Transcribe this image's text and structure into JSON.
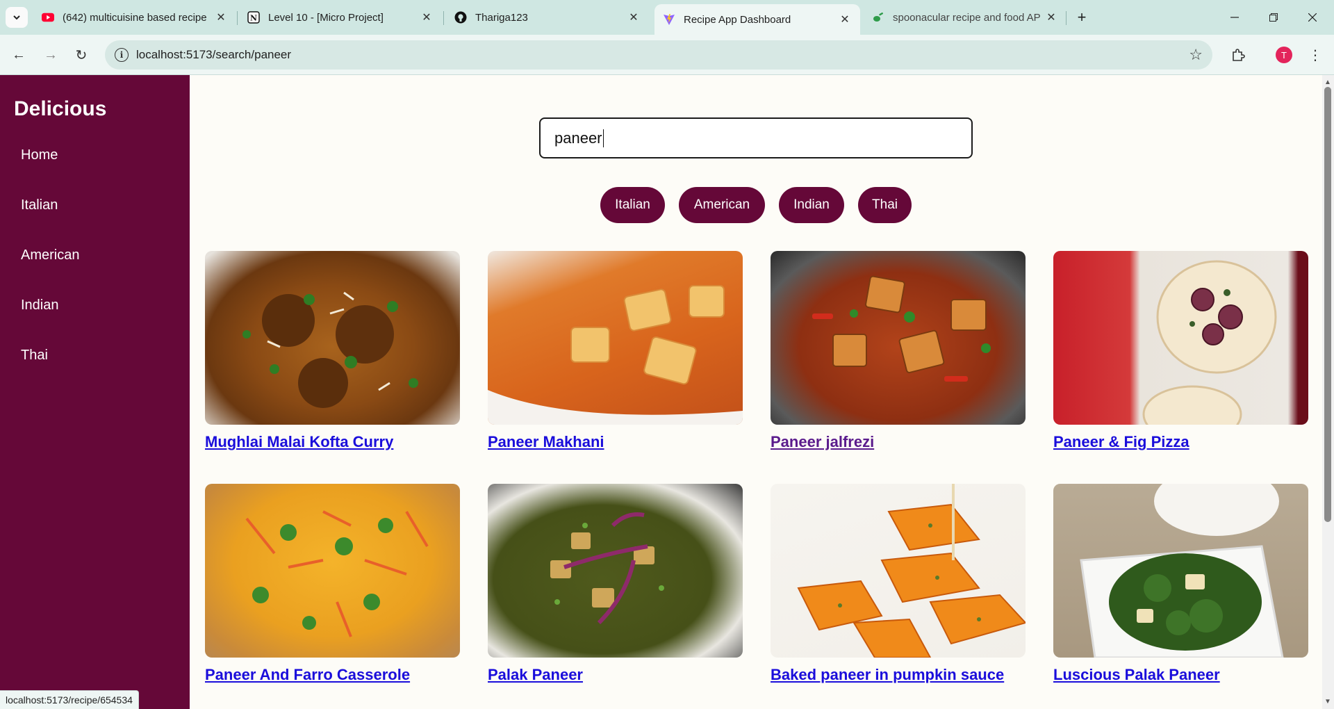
{
  "browser": {
    "tabs": [
      {
        "title": "(642) multicuisine based recipe",
        "favicon": "youtube-icon"
      },
      {
        "title": "Level 10 - [Micro Project]",
        "favicon": "notion-icon"
      },
      {
        "title": "Thariga123",
        "favicon": "github-icon"
      },
      {
        "title": "Recipe App Dashboard",
        "favicon": "vite-icon",
        "active": true
      },
      {
        "title": "spoonacular recipe and food AP",
        "favicon": "spoonacular-icon"
      }
    ],
    "url": "localhost:5173/search/paneer",
    "profile_initial": "T",
    "status_url": "localhost:5173/recipe/654534"
  },
  "sidebar": {
    "brand": "Delicious",
    "items": [
      "Home",
      "Italian",
      "American",
      "Indian",
      "Thai"
    ]
  },
  "search": {
    "value": "paneer"
  },
  "cuisines": [
    "Italian",
    "American",
    "Indian",
    "Thai"
  ],
  "recipes": [
    {
      "name": "Mughlai Malai Kofta Curry",
      "visited": false
    },
    {
      "name": "Paneer Makhani",
      "visited": false
    },
    {
      "name": "Paneer jalfrezi",
      "visited": true
    },
    {
      "name": "Paneer & Fig Pizza",
      "visited": false
    },
    {
      "name": "Paneer And Farro Casserole",
      "visited": false
    },
    {
      "name": "Palak Paneer",
      "visited": false
    },
    {
      "name": "Baked paneer in pumpkin sauce",
      "visited": false
    },
    {
      "name": "Luscious Palak Paneer",
      "visited": false
    }
  ],
  "colors": {
    "brand": "#650838",
    "link": "#1a0ddb",
    "visited_link": "#5a1a8c",
    "page_bg": "#fdfcf7"
  }
}
